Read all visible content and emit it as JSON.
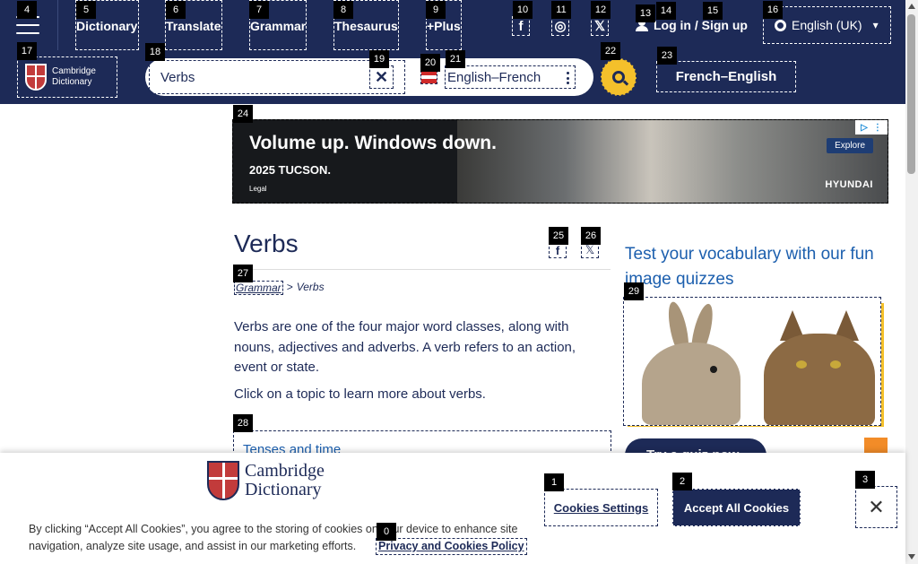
{
  "nav": {
    "dictionary": "Dictionary",
    "translate": "Translate",
    "grammar": "Grammar",
    "thesaurus": "Thesaurus",
    "plus": "+Plus",
    "facebook_glyph": "f",
    "instagram_glyph": "◎",
    "x_glyph": "𝕏",
    "login": "Log in / Sign up",
    "language": "English (UK)"
  },
  "search": {
    "value": "Verbs",
    "dictionary": "English–French",
    "clear_glyph": "✕",
    "alt_dictionary": "French–English"
  },
  "logo": {
    "line1": "Cambridge",
    "line2": "Dictionary"
  },
  "ad": {
    "headline": "Volume up. Windows down.",
    "sub": "2025 TUCSON.",
    "legal": "Legal",
    "explore": "Explore",
    "brand": "HYUNDAI"
  },
  "article": {
    "title": "Verbs",
    "breadcrumb_link": "Grammar",
    "breadcrumb_separator": ">",
    "breadcrumb_current": "Verbs",
    "paragraph1": "Verbs are one of the four major word classes, along with nouns, adjectives and adverbs. A verb refers to an action, event or state.",
    "paragraph2": "Click on a topic to learn more about verbs.",
    "topic1": "Tenses and time",
    "share_fb_glyph": "f",
    "share_x_glyph": "𝕏"
  },
  "sidebar": {
    "quiz_title": "Test your vocabulary with our fun image quizzes",
    "try_button": "Try a quiz now"
  },
  "cookie": {
    "logo_line1": "Cambridge",
    "logo_line2": "Dictionary",
    "text": "By clicking “Accept All Cookies”, you agree to the storing of cookies on your device to enhance site navigation, analyze site usage, and assist in our marketing efforts.",
    "policy": "Privacy and Cookies Policy",
    "settings": "Cookies Settings",
    "accept": "Accept All Cookies",
    "close_glyph": "✕"
  },
  "badges": [
    "0",
    "1",
    "2",
    "3",
    "4",
    "5",
    "6",
    "7",
    "8",
    "9",
    "10",
    "11",
    "12",
    "13",
    "14",
    "15",
    "16",
    "17",
    "18",
    "19",
    "20",
    "21",
    "22",
    "23",
    "24",
    "25",
    "26",
    "27",
    "28",
    "29"
  ],
  "colors": {
    "brand_navy": "#1d2a57",
    "accent_yellow": "#f4c02b",
    "link_blue": "#1c5fae",
    "orange": "#f28c28"
  }
}
